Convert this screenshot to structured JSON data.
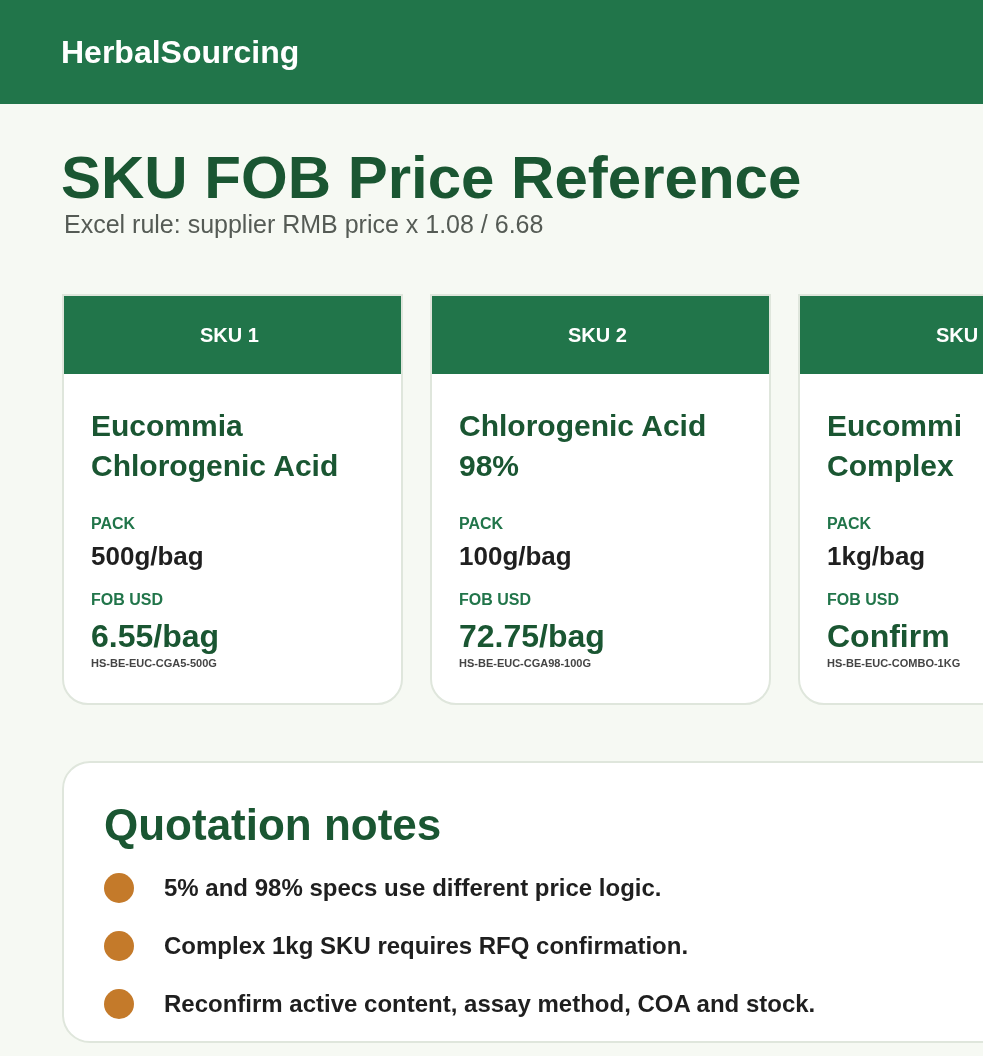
{
  "brand": "HerbalSourcing",
  "title": "SKU FOB Price Reference",
  "subtitle": "Excel rule: supplier RMB price x 1.08 / 6.68",
  "skus": [
    {
      "label": "SKU 1",
      "name": "Eucommia Chlorogenic Acid",
      "pack_label": "PACK",
      "pack": "500g/bag",
      "fob_label": "FOB USD",
      "fob": "6.55/bag",
      "code": "HS-BE-EUC-CGA5-500G"
    },
    {
      "label": "SKU 2",
      "name": "Chlorogenic Acid 98%",
      "pack_label": "PACK",
      "pack": "100g/bag",
      "fob_label": "FOB USD",
      "fob": "72.75/bag",
      "code": "HS-BE-EUC-CGA98-100G"
    },
    {
      "label": "SKU",
      "name": "Eucommi\nComplex",
      "pack_label": "PACK",
      "pack": "1kg/bag",
      "fob_label": "FOB USD",
      "fob": "Confirm",
      "code": "HS-BE-EUC-COMBO-1KG"
    }
  ],
  "notes": {
    "title": "Quotation notes",
    "items": [
      {
        "text": "5% and 98% specs use different price logic.",
        "color": "#c47a2a"
      },
      {
        "text": "Complex 1kg SKU requires RFQ confirmation.",
        "color": "#c47a2a"
      },
      {
        "text": "Reconfirm active content, assay method, COA and stock.",
        "color": "#c47a2a"
      }
    ]
  }
}
